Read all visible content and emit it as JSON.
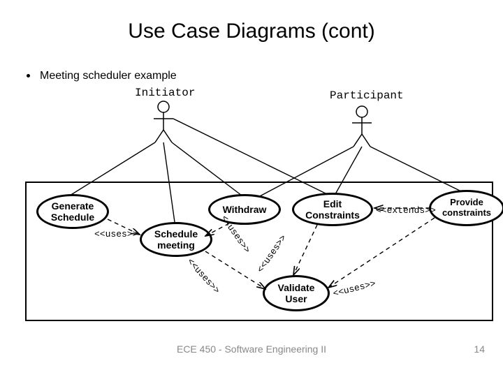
{
  "title": "Use Case Diagrams (cont)",
  "bullet": "Meeting scheduler example",
  "actors": {
    "initiator": "Initiator",
    "participant": "Participant"
  },
  "usecases": {
    "generate_schedule": "Generate\nSchedule",
    "schedule_meeting": "Schedule\nmeeting",
    "withdraw": "Withdraw",
    "edit_constraints": "Edit\nConstraints",
    "provide_constraints": "Provide\nconstraints",
    "validate_user": "Validate\nUser"
  },
  "stereotypes": {
    "uses1": "<<uses>>",
    "uses2": "<<uses>>",
    "uses3": "<<uses>>",
    "uses4": "<<uses>>",
    "uses5": "<<uses>>",
    "extends": "<<extends>>"
  },
  "footer": "ECE 450 - Software Engineering II",
  "pagenum": "14"
}
